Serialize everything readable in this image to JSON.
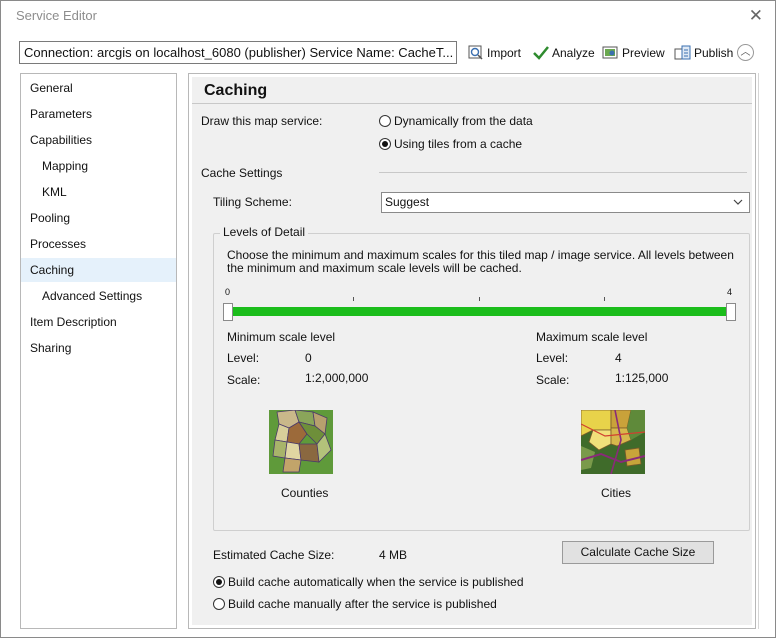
{
  "window": {
    "title": "Service Editor"
  },
  "toolbar": {
    "connection_text": "Connection: arcgis on localhost_6080 (publisher)   Service Name: CacheT...",
    "import_label": "Import",
    "analyze_label": "Analyze",
    "preview_label": "Preview",
    "publish_label": "Publish"
  },
  "sidebar": {
    "items": [
      {
        "label": "General"
      },
      {
        "label": "Parameters"
      },
      {
        "label": "Capabilities"
      },
      {
        "label": "Mapping"
      },
      {
        "label": "KML"
      },
      {
        "label": "Pooling"
      },
      {
        "label": "Processes"
      },
      {
        "label": "Caching"
      },
      {
        "label": "Advanced Settings"
      },
      {
        "label": "Item Description"
      },
      {
        "label": "Sharing"
      }
    ],
    "selected": "Caching"
  },
  "caching": {
    "heading": "Caching",
    "draw_label": "Draw this map service:",
    "option_dynamic": "Dynamically from the data",
    "option_tiles": "Using tiles from a cache",
    "selected_draw": "tiles",
    "cache_settings_label": "Cache Settings",
    "tiling_scheme_label": "Tiling Scheme:",
    "tiling_scheme_value": "Suggest",
    "lod_title": "Levels of Detail",
    "lod_description": "Choose the minimum and maximum scales for this tiled map / image service. All levels between the minimum and maximum scale levels will be cached.",
    "slider": {
      "min_label": "0",
      "max_label": "4",
      "min_fraction": 0,
      "max_fraction": 1
    },
    "min": {
      "title": "Minimum scale level",
      "level_label": "Level:",
      "level_value": "0",
      "scale_label": "Scale:",
      "scale_value": "1:2,000,000",
      "caption": "Counties"
    },
    "max": {
      "title": "Maximum scale level",
      "level_label": "Level:",
      "level_value": "4",
      "scale_label": "Scale:",
      "scale_value": "1:125,000",
      "caption": "Cities"
    },
    "estimated_label": "Estimated Cache Size:",
    "estimated_value": "4 MB",
    "calculate_label": "Calculate Cache Size",
    "build_auto": "Build cache automatically when the service is published",
    "build_manual": "Build cache manually after the service is published",
    "selected_build": "auto"
  },
  "colors": {
    "accent_green": "#1bbd1b",
    "selection": "#e5f1fb",
    "panel_bg": "#f0f0f0"
  }
}
